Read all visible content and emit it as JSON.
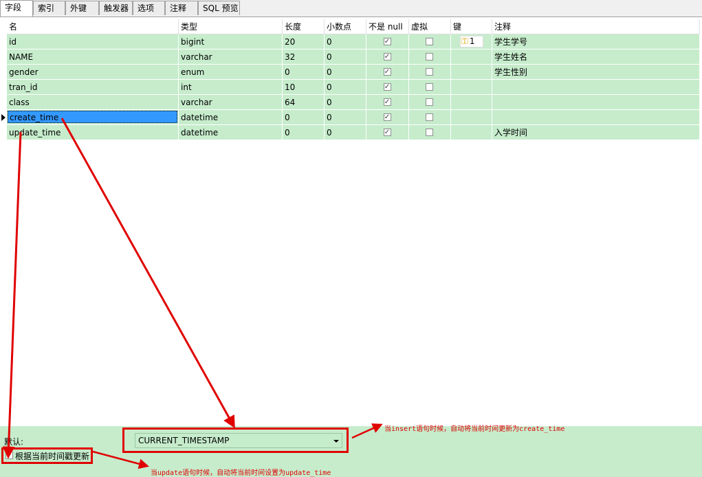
{
  "tabs": [
    {
      "label": "字段",
      "active": true
    },
    {
      "label": "索引",
      "active": false
    },
    {
      "label": "外键",
      "active": false
    },
    {
      "label": "触发器",
      "active": false
    },
    {
      "label": "选项",
      "active": false
    },
    {
      "label": "注释",
      "active": false
    },
    {
      "label": "SQL 预览",
      "active": false
    }
  ],
  "grid": {
    "headers": [
      "名",
      "类型",
      "长度",
      "小数点",
      "不是 null",
      "虚拟",
      "键",
      "注释"
    ],
    "rows": [
      {
        "name": "id",
        "type": "bigint",
        "length": "20",
        "decimals": "0",
        "not_null": true,
        "virtual": false,
        "key": "1",
        "comment": "学生学号"
      },
      {
        "name": "NAME",
        "type": "varchar",
        "length": "32",
        "decimals": "0",
        "not_null": true,
        "virtual": false,
        "key": "",
        "comment": "学生姓名"
      },
      {
        "name": "gender",
        "type": "enum",
        "length": "0",
        "decimals": "0",
        "not_null": true,
        "virtual": false,
        "key": "",
        "comment": "学生性别"
      },
      {
        "name": "tran_id",
        "type": "int",
        "length": "10",
        "decimals": "0",
        "not_null": true,
        "virtual": false,
        "key": "",
        "comment": ""
      },
      {
        "name": "class",
        "type": "varchar",
        "length": "64",
        "decimals": "0",
        "not_null": true,
        "virtual": false,
        "key": "",
        "comment": ""
      },
      {
        "name": "create_time",
        "type": "datetime",
        "length": "0",
        "decimals": "0",
        "not_null": true,
        "virtual": false,
        "key": "",
        "comment": "",
        "selected": true
      },
      {
        "name": "update_time",
        "type": "datetime",
        "length": "0",
        "decimals": "0",
        "not_null": true,
        "virtual": false,
        "key": "",
        "comment": "入学时间"
      }
    ]
  },
  "field_props": {
    "default_label": "默认:",
    "default_value": "CURRENT_TIMESTAMP",
    "on_update_label": "根据当前时间戳更新",
    "on_update_checked": false
  },
  "annotations": {
    "insert_note": "当insert语句时候，自动将当前时间更新为create_time",
    "update_note": "当update语句时候，自动将当前时间设置为update_time",
    "color": "#e00000"
  },
  "colors": {
    "row_bg": "#c6eccc",
    "selection": "#3399ff"
  }
}
